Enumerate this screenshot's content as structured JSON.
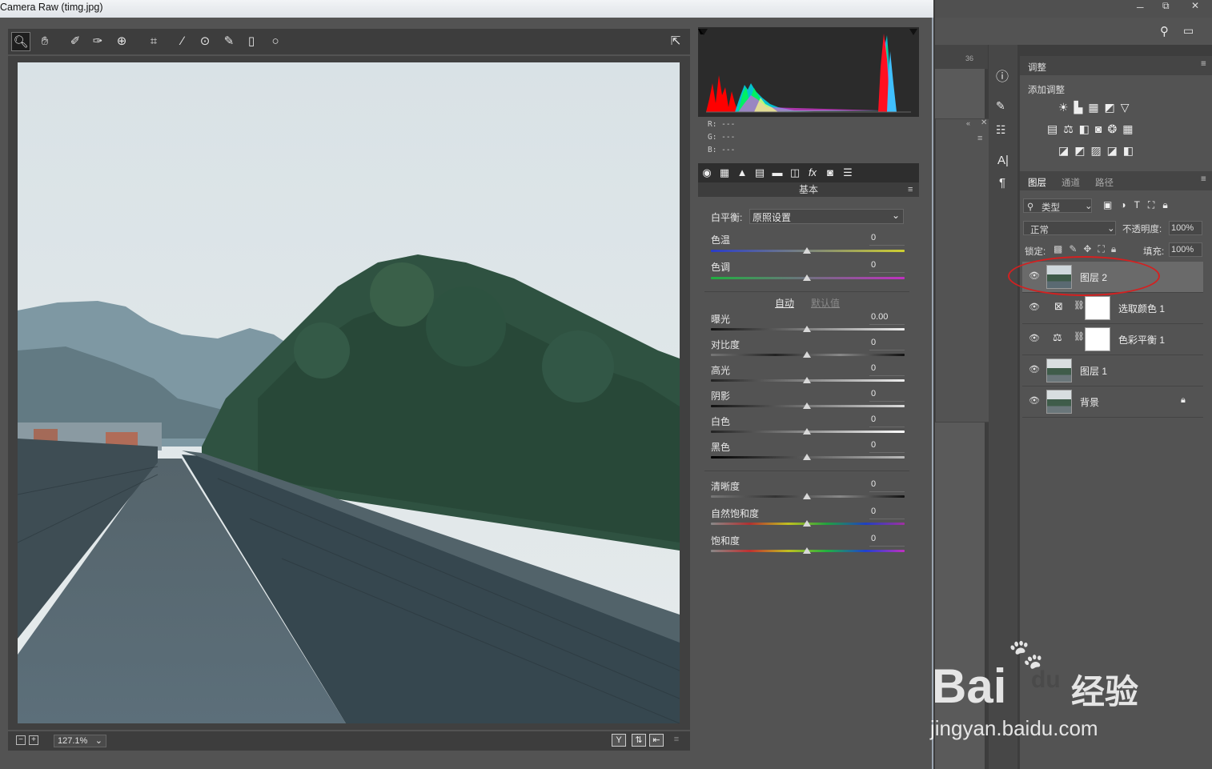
{
  "window": {
    "title": "Camera Raw (timg.jpg)"
  },
  "toolbar": {
    "tools": [
      "zoom-icon",
      "hand-icon",
      "white-balance-icon",
      "color-sampler-icon",
      "targeted-adjust-icon",
      "crop-icon",
      "straighten-icon",
      "spot-removal-icon",
      "brush-icon",
      "graduated-filter-icon",
      "radial-filter-icon"
    ]
  },
  "readout": {
    "r": "R:  ---",
    "g": "G:  ---",
    "b": "B:  ---"
  },
  "panel": {
    "title": "基本",
    "white_balance_label": "白平衡:",
    "white_balance_value": "原照设置",
    "auto_label": "自动",
    "default_label": "默认值",
    "sliders": [
      {
        "label": "色温",
        "value": "0"
      },
      {
        "label": "色调",
        "value": "0"
      },
      {
        "label": "曝光",
        "value": "0.00"
      },
      {
        "label": "对比度",
        "value": "0"
      },
      {
        "label": "高光",
        "value": "0"
      },
      {
        "label": "阴影",
        "value": "0"
      },
      {
        "label": "白色",
        "value": "0"
      },
      {
        "label": "黑色",
        "value": "0"
      },
      {
        "label": "清晰度",
        "value": "0"
      },
      {
        "label": "自然饱和度",
        "value": "0"
      },
      {
        "label": "饱和度",
        "value": "0"
      }
    ]
  },
  "bottombar": {
    "zoom": "127.1%",
    "y_button": "Y"
  },
  "ps": {
    "adjust_tab": "调整",
    "add_adjust": "添加调整",
    "tabs": [
      "图层",
      "通道",
      "路径"
    ],
    "filter_kind": "类型",
    "blend_mode": "正常",
    "opacity_label": "不透明度:",
    "opacity_value": "100%",
    "lock_label": "锁定:",
    "fill_label": "填充:",
    "fill_value": "100%",
    "ruler_num": "36",
    "layers": [
      {
        "name": "图层 2",
        "kind": "smart-photo",
        "selected": true
      },
      {
        "name": "选取颜色 1",
        "kind": "selective-color"
      },
      {
        "name": "色彩平衡 1",
        "kind": "color-balance"
      },
      {
        "name": "图层 1",
        "kind": "photo"
      },
      {
        "name": "背景",
        "kind": "photo-locked"
      }
    ]
  },
  "watermark": {
    "brand": "Bai",
    "brand2": "du",
    "cn": "经验",
    "url": "jingyan.baidu.com"
  }
}
